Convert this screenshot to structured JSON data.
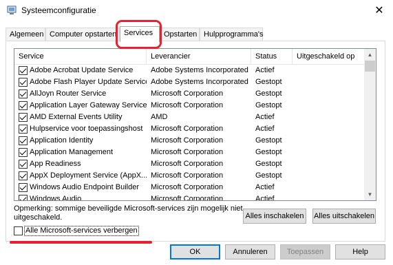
{
  "window": {
    "title": "Systeemconfiguratie",
    "close_glyph": "✕"
  },
  "tabs": [
    {
      "label": "Algemeen"
    },
    {
      "label": "Computer opstarten"
    },
    {
      "label": "Services",
      "active": true
    },
    {
      "label": "Opstarten"
    },
    {
      "label": "Hulpprogramma's"
    }
  ],
  "columns": {
    "service": "Service",
    "vendor": "Leverancier",
    "status": "Status",
    "disabled": "Uitgeschakeld op"
  },
  "services": [
    {
      "name": "Adobe Acrobat Update Service",
      "vendor": "Adobe Systems Incorporated",
      "status": "Actief",
      "checked": true
    },
    {
      "name": "Adobe Flash Player Update Service",
      "vendor": "Adobe Systems Incorporated",
      "status": "Gestopt",
      "checked": true
    },
    {
      "name": "AllJoyn Router Service",
      "vendor": "Microsoft Corporation",
      "status": "Gestopt",
      "checked": true
    },
    {
      "name": "Application Layer Gateway Service",
      "vendor": "Microsoft Corporation",
      "status": "Gestopt",
      "checked": true
    },
    {
      "name": "AMD External Events Utility",
      "vendor": "AMD",
      "status": "Actief",
      "checked": true
    },
    {
      "name": "Hulpservice voor toepassingshost",
      "vendor": "Microsoft Corporation",
      "status": "Actief",
      "checked": true
    },
    {
      "name": "Application Identity",
      "vendor": "Microsoft Corporation",
      "status": "Gestopt",
      "checked": true
    },
    {
      "name": "Application Management",
      "vendor": "Microsoft Corporation",
      "status": "Gestopt",
      "checked": true
    },
    {
      "name": "App Readiness",
      "vendor": "Microsoft Corporation",
      "status": "Gestopt",
      "checked": true
    },
    {
      "name": "AppX Deployment Service (AppX...",
      "vendor": "Microsoft Corporation",
      "status": "Gestopt",
      "checked": true
    },
    {
      "name": "Windows Audio Endpoint Builder",
      "vendor": "Microsoft Corporation",
      "status": "Actief",
      "checked": true
    },
    {
      "name": "Windows Audio",
      "vendor": "Microsoft Corporation",
      "status": "Actief",
      "checked": true
    }
  ],
  "note": "Opmerking: sommige beveiligde Microsoft-services zijn mogelijk niet uitgeschakeld.",
  "hide_ms_label": "Alle Microsoft-services verbergen",
  "buttons": {
    "enable_all": "Alles inschakelen",
    "disable_all": "Alles uitschakelen",
    "ok": "OK",
    "cancel": "Annuleren",
    "apply": "Toepassen",
    "help": "Help"
  },
  "colors": {
    "annotation": "#e8202f",
    "focus": "#0078d7"
  }
}
